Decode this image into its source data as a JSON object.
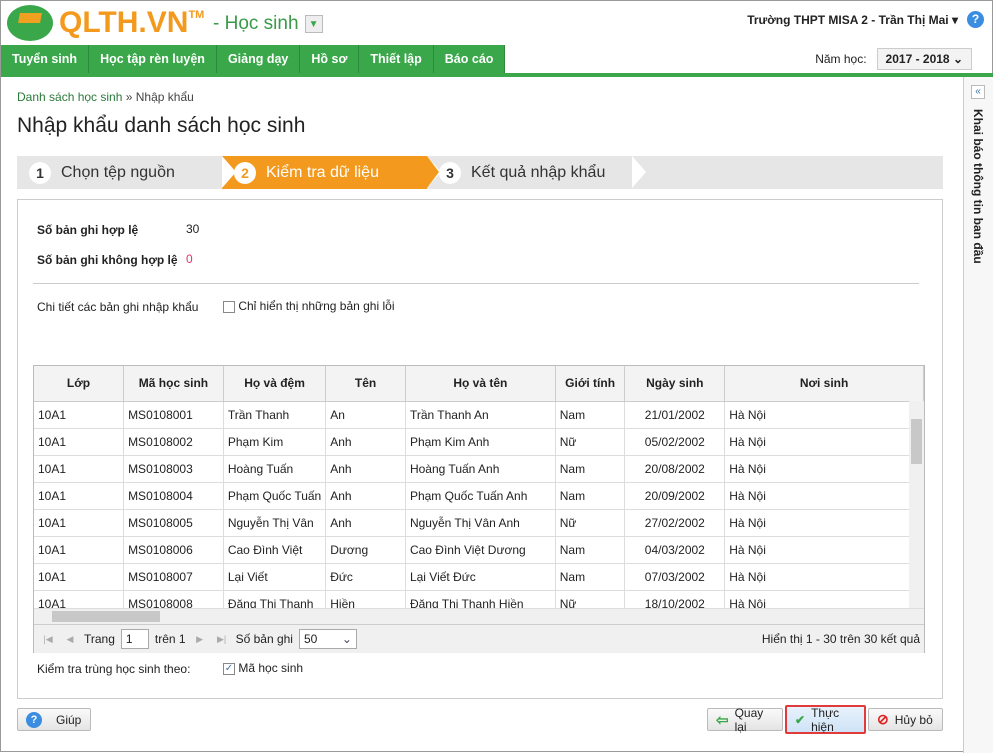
{
  "header": {
    "brand": "QLTH.VN",
    "tm": "TM",
    "module": "- Học sinh",
    "user": "Trường THPT MISA 2 - Trần Thị Mai ▾",
    "help": "?"
  },
  "nav": [
    "Tuyển sinh",
    "Học tập rèn luyện",
    "Giảng dạy",
    "Hồ sơ",
    "Thiết lập",
    "Báo cáo"
  ],
  "year": {
    "label": "Năm học:",
    "value": "2017 - 2018"
  },
  "sidebar": {
    "collapse": "«",
    "title": "Khai báo thông tin ban đầu"
  },
  "breadcrumb": {
    "parent": "Danh sách học sinh",
    "sep": " » ",
    "current": "Nhập khẩu"
  },
  "title": "Nhập khẩu danh sách học sinh",
  "steps": [
    {
      "n": "1",
      "label": "Chọn tệp nguồn"
    },
    {
      "n": "2",
      "label": "Kiểm tra dữ liệu"
    },
    {
      "n": "3",
      "label": "Kết quả nhập khẩu"
    }
  ],
  "summary": {
    "valid_label": "Số bản ghi hợp lệ",
    "valid": "30",
    "invalid_label": "Số bản ghi không hợp lệ",
    "invalid": "0"
  },
  "details": {
    "label": "Chi tiết các bản ghi nhập khẩu",
    "only_errors": "Chỉ hiển thị những bản ghi lỗi",
    "only_errors_checked": false
  },
  "table": {
    "columns": [
      "Lớp",
      "Mã học sinh",
      "Họ và đệm",
      "Tên",
      "Họ và tên",
      "Giới tính",
      "Ngày sinh",
      "Nơi sinh"
    ],
    "rows": [
      [
        "10A1",
        "MS0108001",
        "Trần Thanh",
        "An",
        "Trần Thanh An",
        "Nam",
        "21/01/2002",
        "Hà Nội"
      ],
      [
        "10A1",
        "MS0108002",
        "Phạm Kim",
        "Anh",
        "Phạm Kim Anh",
        "Nữ",
        "05/02/2002",
        "Hà Nội"
      ],
      [
        "10A1",
        "MS0108003",
        "Hoàng Tuấn",
        "Anh",
        "Hoàng Tuấn Anh",
        "Nam",
        "20/08/2002",
        "Hà Nội"
      ],
      [
        "10A1",
        "MS0108004",
        "Phạm Quốc Tuấn",
        "Anh",
        "Phạm Quốc Tuấn Anh",
        "Nam",
        "20/09/2002",
        "Hà Nội"
      ],
      [
        "10A1",
        "MS0108005",
        "Nguyễn Thị Vân",
        "Anh",
        "Nguyễn Thị Vân Anh",
        "Nữ",
        "27/02/2002",
        "Hà Nội"
      ],
      [
        "10A1",
        "MS0108006",
        "Cao Đình Việt",
        "Dương",
        "Cao Đình Việt Dương",
        "Nam",
        "04/03/2002",
        "Hà Nội"
      ],
      [
        "10A1",
        "MS0108007",
        "Lại Viết",
        "Đức",
        "Lại Viết Đức",
        "Nam",
        "07/03/2002",
        "Hà Nội"
      ],
      [
        "10A1",
        "MS0108008",
        "Đặng Thị Thanh",
        "Hiền",
        "Đặng Thị Thanh Hiền",
        "Nữ",
        "18/10/2002",
        "Hà Nội"
      ]
    ]
  },
  "pager": {
    "page_label": "Trang",
    "page": "1",
    "of": "trên 1",
    "size_label": "Số bản ghi",
    "size": "50",
    "info": "Hiển thị 1 - 30 trên 30 kết quả"
  },
  "dup": {
    "label": "Kiểm tra trùng học sinh theo:",
    "option": "Mã học sinh",
    "checked": true
  },
  "buttons": {
    "help": "Giúp",
    "back": "Quay lại",
    "run": "Thực hiện",
    "cancel": "Hủy bỏ"
  }
}
